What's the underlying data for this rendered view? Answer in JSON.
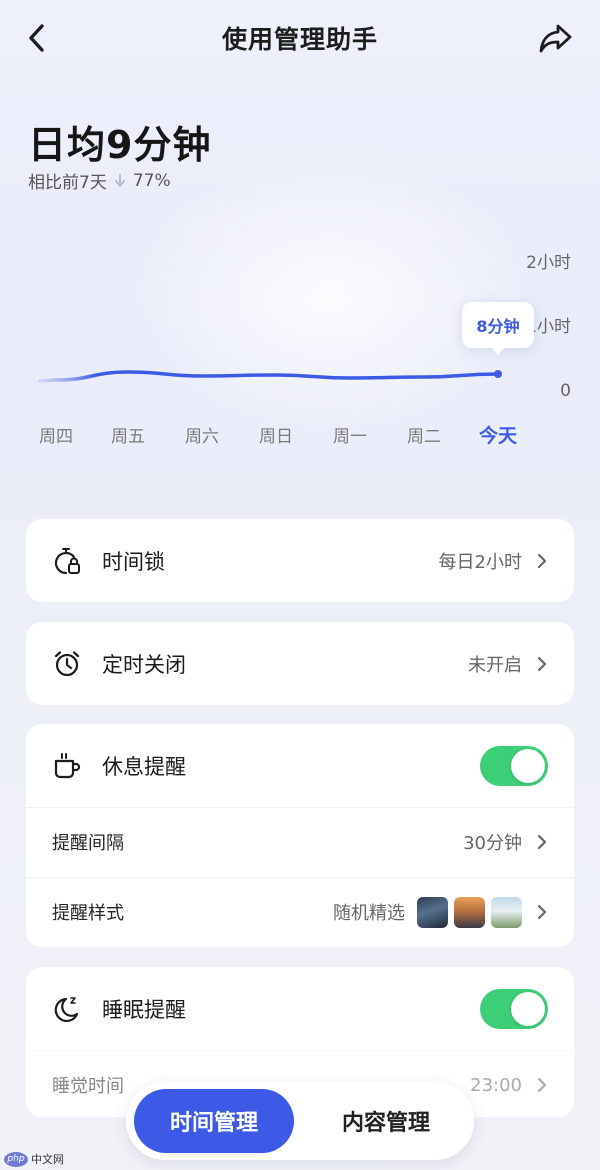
{
  "nav": {
    "title": "使用管理助手"
  },
  "summary": {
    "title": "日均9分钟",
    "compare_label": "相比前7天",
    "change": "77%"
  },
  "chart_data": {
    "type": "line",
    "categories": [
      "周四",
      "周五",
      "周六",
      "周日",
      "周一",
      "周二",
      "今天"
    ],
    "values": [
      2,
      10,
      6,
      7,
      4,
      5,
      8
    ],
    "unit": "分钟",
    "y_ticks": [
      "2小时",
      "1小时",
      "0"
    ],
    "ylim": [
      0,
      120
    ],
    "highlight_index": 6,
    "tooltip": "8分钟",
    "colors": {
      "line": "#3d5ae6",
      "active_label": "#3d5ae6",
      "label": "#7a7a7a"
    }
  },
  "settings": {
    "time_lock": {
      "label": "时间锁",
      "value": "每日2小时",
      "icon": "timer-lock-icon"
    },
    "scheduled_close": {
      "label": "定时关闭",
      "value": "未开启",
      "icon": "alarm-clock-icon"
    },
    "rest_reminder": {
      "label": "休息提醒",
      "icon": "coffee-cup-icon",
      "enabled": true,
      "interval_label": "提醒间隔",
      "interval_value": "30分钟",
      "style_label": "提醒样式",
      "style_value": "随机精选"
    },
    "sleep_reminder": {
      "label": "睡眠提醒",
      "icon": "moon-sleep-icon",
      "enabled": true,
      "bedtime_label": "睡觉时间",
      "bedtime_value": "23:00"
    }
  },
  "bottom_tabs": {
    "active": "时间管理",
    "inactive": "内容管理"
  },
  "watermark": {
    "logo": "php",
    "text": "中文网"
  },
  "colors": {
    "accent": "#3d5ae6",
    "toggle_on": "#3ccf78"
  }
}
